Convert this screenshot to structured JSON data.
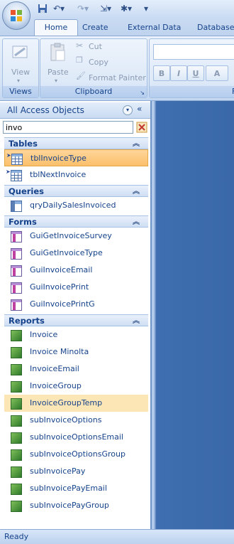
{
  "ribbon": {
    "tabs": [
      "Home",
      "Create",
      "External Data",
      "Database T"
    ],
    "groups": {
      "views": "Views",
      "clipboard": "Clipboard"
    },
    "view_label": "View",
    "paste_label": "Paste",
    "cut_label": "Cut",
    "copy_label": "Copy",
    "format_painter_label": "Format Painter",
    "format_buttons": [
      "B",
      "I",
      "U",
      "A"
    ],
    "group_clipped_label": "F"
  },
  "nav": {
    "title": "All Access Objects",
    "search_value": "invo",
    "sections": [
      {
        "label": "Tables",
        "items": [
          "tblInvoiceType",
          "tblNextInvoice"
        ]
      },
      {
        "label": "Queries",
        "items": [
          "qryDailySalesInvoiced"
        ]
      },
      {
        "label": "Forms",
        "items": [
          "GuiGetInvoiceSurvey",
          "GuiGetInvoiceType",
          "GuiInvoiceEmail",
          "GuiInvoicePrint",
          "GuiInvoicePrintG"
        ]
      },
      {
        "label": "Reports",
        "items": [
          "Invoice",
          "Invoice Minolta",
          "InvoiceEmail",
          "InvoiceGroup",
          "InvoiceGroupTemp",
          "subInvoiceOptions",
          "subInvoiceOptionsEmail",
          "subInvoiceOptionsGroup",
          "subInvoicePay",
          "subInvoicePayEmail",
          "subInvoicePayGroup"
        ]
      }
    ]
  },
  "status": {
    "text": "Ready"
  },
  "colors": {
    "accent": "#15428b",
    "selected": "#fbc06b",
    "workspace": "#3a68a8"
  }
}
